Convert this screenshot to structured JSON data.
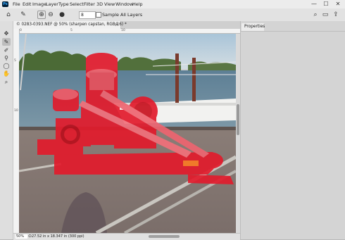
{
  "app": {
    "logo_text": "Ps"
  },
  "menu": [
    "File",
    "Edit",
    "Image",
    "Layer",
    "Type",
    "Select",
    "Filter",
    "3D",
    "View",
    "Window",
    "Help"
  ],
  "window_controls": {
    "minimize": "—",
    "maximize": "☐",
    "close": "✕"
  },
  "options_bar": {
    "brush_size": "8",
    "sample_all_layers_label": "Sample All Layers",
    "sample_all_layers_checked": false
  },
  "document": {
    "tab_title": "© 0283-0393.NEF @ 50% (sharpen capstan, RGB/16) *",
    "close_glyph": "×",
    "zoom": "50%",
    "info": "27.52 in x 18.347 in (300 ppi)",
    "ruler_top_labels": [
      "0",
      "5",
      "10"
    ],
    "ruler_left_labels": [
      "5",
      "10"
    ]
  },
  "properties_panel": {
    "tab_label": "Properties"
  },
  "colors": {
    "mask_overlay": "#e21b2c",
    "workspace": "#b9b9b9",
    "menubar": "#ececec"
  },
  "icons": [
    "home-icon",
    "quick-mask-brush-icon",
    "brush-add-icon",
    "brush-subtract-icon",
    "search-icon",
    "workspace-icon",
    "share-icon",
    "move-icon",
    "quick-selection-icon",
    "brush-icon",
    "stamp-icon",
    "lasso-icon",
    "hand-icon",
    "zoom-icon"
  ]
}
